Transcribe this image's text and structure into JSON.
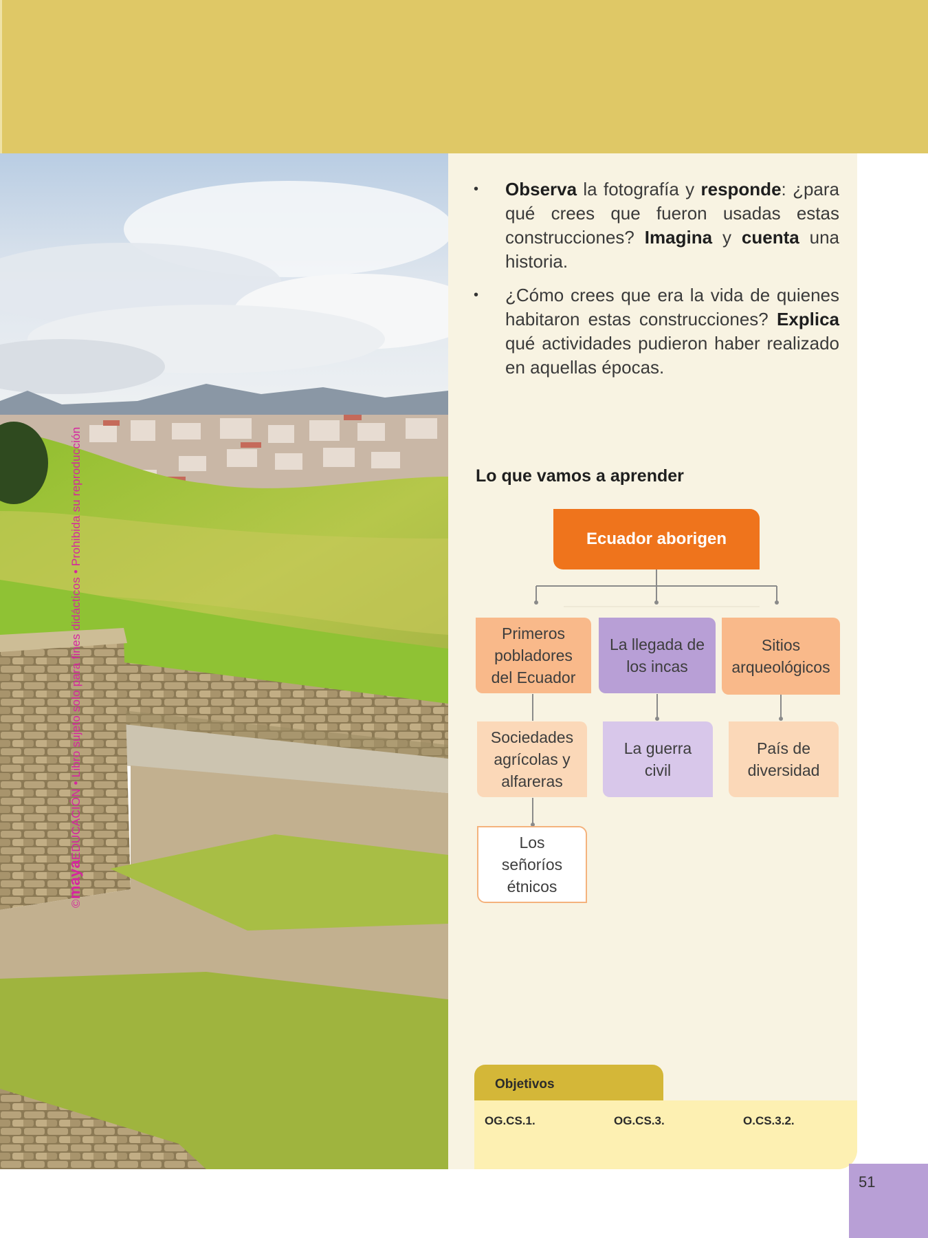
{
  "watermark": {
    "brand": "maya",
    "prefix": "©",
    "text": "EDUCACIÓN • Libro sujeto solo para fines didácticos • Prohibida su reproducción"
  },
  "questions": [
    {
      "parts": [
        {
          "t": "Observa",
          "b": true
        },
        {
          "t": " la fotografía y ",
          "b": false
        },
        {
          "t": "responde",
          "b": true
        },
        {
          "t": ": ¿para qué crees que fueron usadas estas construcciones? ",
          "b": false
        },
        {
          "t": "Imagina",
          "b": true
        },
        {
          "t": " y ",
          "b": false
        },
        {
          "t": "cuenta",
          "b": true
        },
        {
          "t": " una historia.",
          "b": false
        }
      ]
    },
    {
      "parts": [
        {
          "t": "¿Cómo crees que era la vida de quienes habitaron estas construcciones? ",
          "b": false
        },
        {
          "t": "Explica",
          "b": true
        },
        {
          "t": " qué actividades pudieron haber realizado en aquellas épocas.",
          "b": false
        }
      ]
    }
  ],
  "section_title": "Lo que vamos a aprender",
  "concept_map": {
    "root": "Ecuador aborigen",
    "branch1": {
      "title": "Primeros pobladores del Ecuador",
      "child": "Sociedades agrícolas y alfareras",
      "grandchild": "Los señoríos étnicos"
    },
    "branch2": {
      "title": "La llegada de los incas",
      "child": "La guerra civil"
    },
    "branch3": {
      "title": "Sitios arqueológicos",
      "child": "País de diversidad"
    }
  },
  "objetivos": {
    "label": "Objetivos",
    "items": [
      "OG.CS.1.",
      "OG.CS.3.",
      "O.CS.3.2."
    ]
  },
  "page_number": "51",
  "colors": {
    "header_band": "#dfc866",
    "root_box": "#ef741c",
    "branch_orange": "#f9b98a",
    "branch_purple": "#b89fd6",
    "child_orange": "#fbd8b8",
    "child_purple": "#d8c7ea",
    "panel": "#f8f3e2",
    "watermark": "#d6249f"
  }
}
